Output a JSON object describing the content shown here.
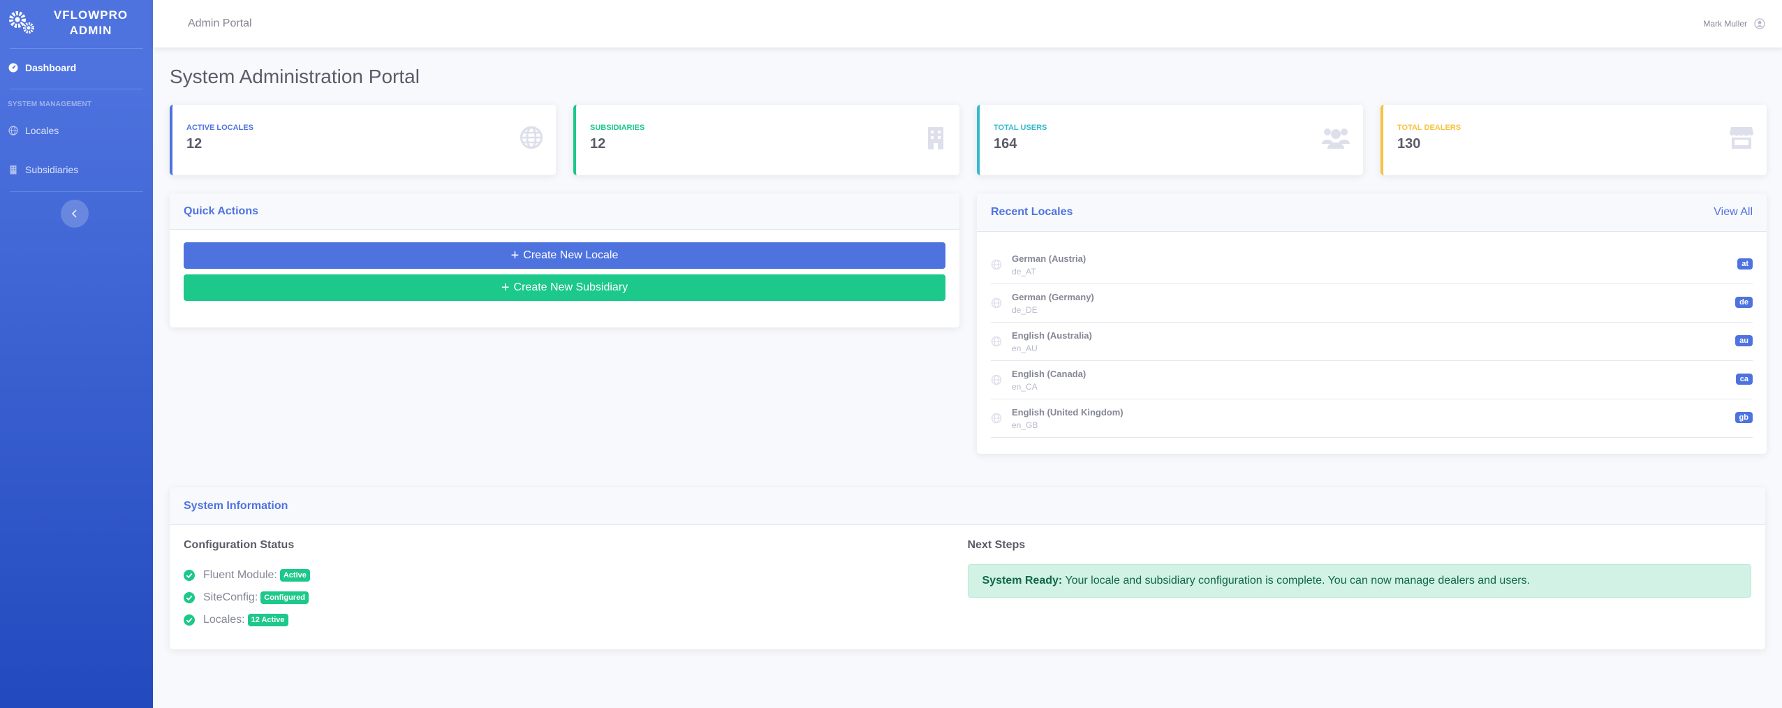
{
  "sidebar": {
    "brand": "VFLOWPRO ADMIN",
    "dashboard_label": "Dashboard",
    "section_heading": "SYSTEM MANAGEMENT",
    "items": [
      {
        "label": "Locales",
        "icon": "globe-icon"
      },
      {
        "label": "Subsidiaries",
        "icon": "building-icon"
      }
    ]
  },
  "topbar": {
    "title": "Admin Portal",
    "user_name": "Mark Muller"
  },
  "page_title": "System Administration Portal",
  "stats": [
    {
      "label": "Active Locales",
      "value": "12",
      "icon": "globe-icon",
      "color": "#4e73df"
    },
    {
      "label": "Subsidiaries",
      "value": "12",
      "icon": "building-icon",
      "color": "#1cc88a"
    },
    {
      "label": "Total Users",
      "value": "164",
      "icon": "users-icon",
      "color": "#36b9cc"
    },
    {
      "label": "Total Dealers",
      "value": "130",
      "icon": "store-icon",
      "color": "#f6c23e"
    }
  ],
  "quick_actions": {
    "title": "Quick Actions",
    "create_locale": "Create New Locale",
    "create_subsidiary": "Create New Subsidiary"
  },
  "recent_locales": {
    "title": "Recent Locales",
    "view_all": "View All",
    "items": [
      {
        "name": "German (Austria)",
        "code": "de_AT",
        "badge": "at"
      },
      {
        "name": "German (Germany)",
        "code": "de_DE",
        "badge": "de"
      },
      {
        "name": "English (Australia)",
        "code": "en_AU",
        "badge": "au"
      },
      {
        "name": "English (Canada)",
        "code": "en_CA",
        "badge": "ca"
      },
      {
        "name": "English (United Kingdom)",
        "code": "en_GB",
        "badge": "gb"
      }
    ]
  },
  "system_info": {
    "title": "System Information",
    "config_title": "Configuration Status",
    "statuses": [
      {
        "label": "Fluent Module:",
        "badge": "Active"
      },
      {
        "label": "SiteConfig:",
        "badge": "Configured"
      },
      {
        "label": "Locales:",
        "badge": "12 Active"
      }
    ],
    "next_title": "Next Steps",
    "alert_strong": "System Ready:",
    "alert_text": " Your locale and subsidiary configuration is complete. You can now manage dealers and users."
  },
  "colors": {
    "primary": "#4e73df",
    "success": "#1cc88a",
    "info": "#36b9cc",
    "warning": "#f6c23e"
  }
}
